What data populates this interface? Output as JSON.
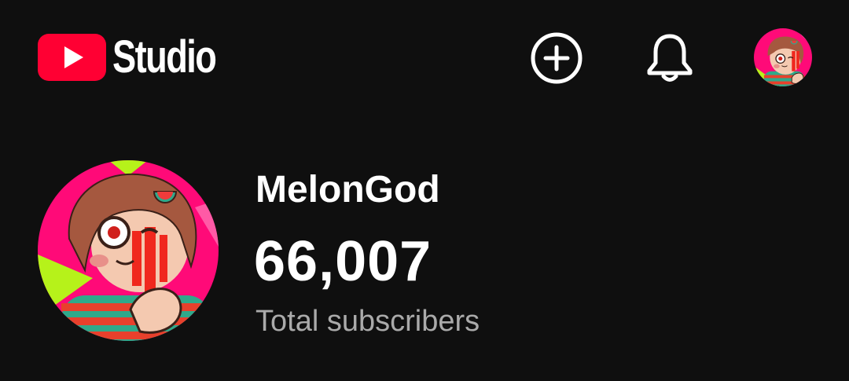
{
  "header": {
    "app_name": "Studio",
    "icons": {
      "logo": "youtube-play-icon",
      "create": "plus-circle-icon",
      "notifications": "bell-icon",
      "account": "channel-avatar"
    }
  },
  "channel": {
    "name": "MelonGod",
    "subscriber_count": "66,007",
    "subscriber_label": "Total subscribers"
  },
  "colors": {
    "background": "#0f0f0f",
    "brand_red": "#ff0033",
    "primary_text": "#ffffff",
    "secondary_text": "#aaaaaa"
  }
}
